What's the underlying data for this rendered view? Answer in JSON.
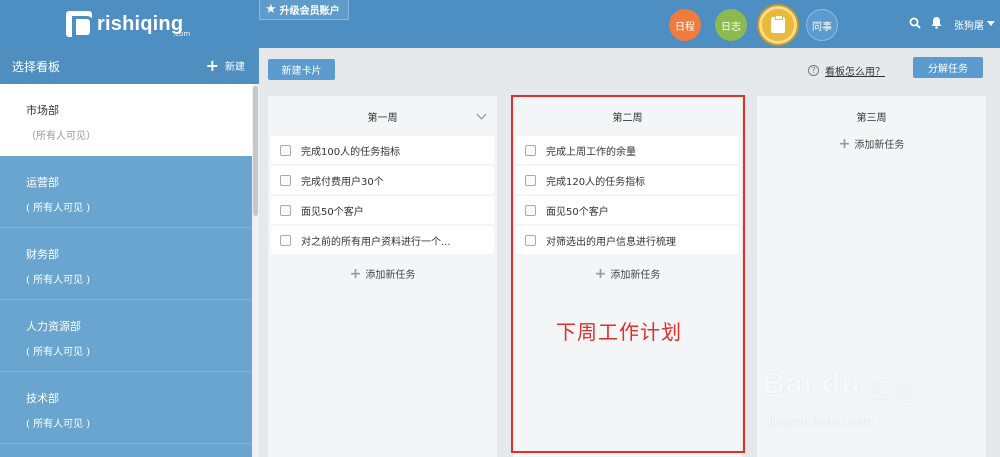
{
  "topbar": {
    "logo_text": "rishiqing",
    "logo_suffix": ".com",
    "upgrade_label": "升级会员账户",
    "nav": {
      "schedule": "日程",
      "log": "日志",
      "colleagues": "同事"
    },
    "username": "张狗屠"
  },
  "sidebar": {
    "title": "选择看板",
    "new_label": "新建",
    "items": [
      {
        "name": "市场部",
        "visibility": "（所有人可见）"
      },
      {
        "name": "运营部",
        "visibility": "( 所有人可见 )"
      },
      {
        "name": "财务部",
        "visibility": "( 所有人可见 )"
      },
      {
        "name": "人力资源部",
        "visibility": "( 所有人可见 )"
      },
      {
        "name": "技术部",
        "visibility": "( 所有人可见 )"
      }
    ]
  },
  "toolbar": {
    "new_card_label": "新建卡片",
    "help_label": "看板怎么用？",
    "split_label": "分解任务"
  },
  "columns": [
    {
      "title": "第一周",
      "tasks": [
        "完成100人的任务指标",
        "完成付费用户30个",
        "面见50个客户",
        "对之前的所有用户资料进行一个..."
      ],
      "add_label": "添加新任务"
    },
    {
      "title": "第二周",
      "tasks": [
        "完成上周工作的余量",
        "完成120人的任务指标",
        "面见50个客户",
        "对筛选出的用户信息进行梳理"
      ],
      "add_label": "添加新任务"
    },
    {
      "title": "第三周",
      "tasks": [],
      "add_label": "添加新任务"
    }
  ],
  "annotation": "下周工作计划",
  "watermark": {
    "brand": "Bai du",
    "brand_cn": "经验",
    "url": "jingyan.baidu.com"
  },
  "colors": {
    "topbar": "#4d8fc2",
    "sidebar": "#6aa5cf",
    "schedule": "#f07b3f",
    "log": "#8dba4e",
    "board": "#e8b93b",
    "highlight": "#e0302a"
  }
}
